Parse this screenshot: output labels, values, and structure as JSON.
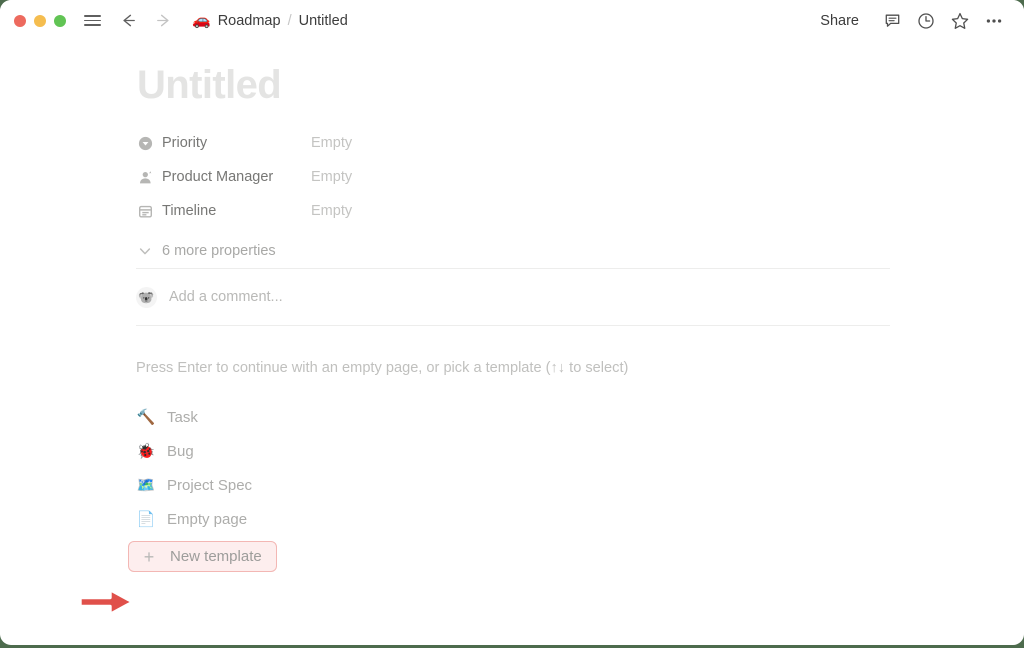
{
  "desktop": {
    "background_color": "#4d6b4d"
  },
  "window": {
    "traffic_lights": [
      {
        "name": "close",
        "color": "#ed6a5e"
      },
      {
        "name": "minimize",
        "color": "#f5bd4f"
      },
      {
        "name": "maximize",
        "color": "#61c454"
      }
    ],
    "sidebar_toggle_icon": "hamburger-icon",
    "back_icon": "arrow-left-icon",
    "forward_icon": "arrow-right-icon"
  },
  "breadcrumb": {
    "database_emoji": "🚗",
    "database": "Roadmap",
    "separator": "/",
    "page": "Untitled"
  },
  "titlebar_actions": {
    "share_label": "Share",
    "comment_icon": "comment-icon",
    "history_icon": "clock-icon",
    "favorite_icon": "star-icon",
    "more_icon": "ellipsis-icon"
  },
  "page": {
    "title": "Untitled",
    "title_placeholder": "Untitled",
    "properties": [
      {
        "icon": "select-chevron-icon",
        "name": "Priority",
        "value": "Empty"
      },
      {
        "icon": "person-icon",
        "name": "Product Manager",
        "value": "Empty"
      },
      {
        "icon": "calendar-icon",
        "name": "Timeline",
        "value": "Empty"
      }
    ],
    "more_properties": {
      "icon": "chevron-down-icon",
      "label": "6 more properties",
      "count": 6
    },
    "comment": {
      "avatar_emoji": "🐨",
      "placeholder": "Add a comment..."
    }
  },
  "template_picker": {
    "hint": "Press Enter to continue with an empty page, or pick a template (↑↓ to select)",
    "items": [
      {
        "emoji": "🔨",
        "label": "Task"
      },
      {
        "emoji": "🐞",
        "label": "Bug"
      },
      {
        "emoji": "🗺️",
        "label": "Project Spec"
      },
      {
        "emoji": "📄",
        "label": "Empty page"
      }
    ],
    "new_template": {
      "plus_icon": "plus-icon",
      "label": "New template",
      "highlighted": true,
      "highlight_fill": "#fdeeee",
      "highlight_border": "#f3b7b4"
    }
  },
  "annotation": {
    "arrow_icon": "arrow-right-annotation",
    "color": "#e0504a",
    "points_to": "New template"
  }
}
